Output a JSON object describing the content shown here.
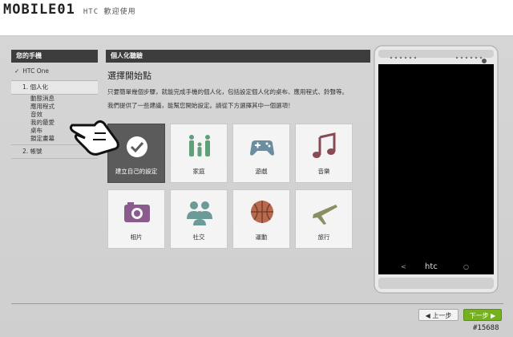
{
  "header": {
    "logo_text": "MOBILE01",
    "subtitle": "HTC 歡迎使用"
  },
  "left_panel": {
    "section_title": "您的手機",
    "device": "HTC One",
    "step1": "1. 個人化",
    "sub_items": [
      "動態消息",
      "應用程式",
      "音效",
      "我的最愛",
      "桌布",
      "鎖定畫幕"
    ],
    "step2": "2. 帳號"
  },
  "main": {
    "section_title": "個人化聽驗",
    "title": "選擇開始點",
    "desc1": "只要簡單幾個步驟，就能完成手機的個人化，包括設定個人化的桌布、應用程式、鈴聲等。",
    "desc2": "我們提供了一些建議，能幫您開始設定。請從下方選擇其中一個選項！",
    "tiles": [
      {
        "label": "建立自己的設定",
        "icon": "check-icon"
      },
      {
        "label": "家庭",
        "icon": "family-icon"
      },
      {
        "label": "遊戲",
        "icon": "gamepad-icon"
      },
      {
        "label": "音樂",
        "icon": "music-note-icon"
      },
      {
        "label": "相片",
        "icon": "camera-icon"
      },
      {
        "label": "社交",
        "icon": "people-icon"
      },
      {
        "label": "運動",
        "icon": "basketball-icon"
      },
      {
        "label": "旅行",
        "icon": "airplane-icon"
      }
    ]
  },
  "phone": {
    "brand": "htc"
  },
  "footer": {
    "prev_label": "◀ 上一步",
    "next_label": "下一步 ▶",
    "watermark": "#15688"
  },
  "colors": {
    "accent_green": "#74b21d",
    "dark_bar": "#3d3d3d",
    "selected_tile": "#5b5b5b"
  }
}
